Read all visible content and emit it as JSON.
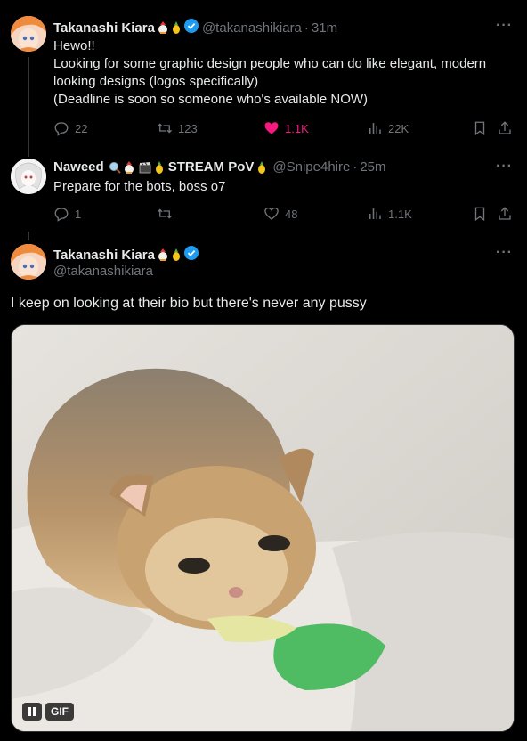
{
  "tweet1": {
    "name": "Takanashi Kiara",
    "handle": "@takanashikiara",
    "time": "31m",
    "lines": [
      "Hewo!!",
      "Looking for some graphic design people who can do like elegant, modern",
      "looking designs (logos specifically)",
      "(Deadline is soon so someone who's available NOW)"
    ],
    "replies": "22",
    "reposts": "123",
    "likes": "1.1K",
    "views": "22K"
  },
  "tweet2": {
    "name": "Naweed",
    "stream_label": "STREAM PoV",
    "handle": "@Snipe4hire",
    "time": "25m",
    "text": "Prepare for the bots, boss o7",
    "replies": "1",
    "reposts": "",
    "likes": "48",
    "views": "1.1K"
  },
  "tweet3": {
    "name": "Takanashi Kiara",
    "handle": "@takanashikiara",
    "text": "I keep on looking at their bio but there's never any pussy",
    "gif_label": "GIF"
  },
  "separator": "·",
  "more_label": "···",
  "icons": [
    "reply-icon",
    "repost-icon",
    "like-icon",
    "views-icon",
    "bookmark-icon",
    "share-icon",
    "verified-icon",
    "pause-icon",
    "more-icon"
  ],
  "colors": {
    "accent_like": "#f91880",
    "verified": "#1d9bf0",
    "muted": "#71767b",
    "text": "#e7e9ea",
    "background": "#000000"
  }
}
